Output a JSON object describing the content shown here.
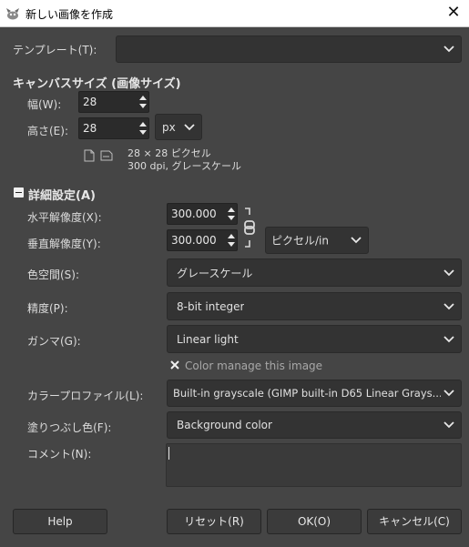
{
  "window": {
    "title": "新しい画像を作成",
    "close_glyph": "✕"
  },
  "template": {
    "label": "テンプレート(T):",
    "value": ""
  },
  "canvas": {
    "section_title": "キャンバスサイズ (画像サイズ)",
    "width_label": "幅(W):",
    "width_value": "28",
    "height_label": "高さ(E):",
    "height_value": "28",
    "unit": "px",
    "info_line1": "28 × 28 ピクセル",
    "info_line2": "300 dpi, グレースケール"
  },
  "advanced": {
    "toggle_glyph": "−",
    "section_title": "詳細設定(A)",
    "xres_label": "水平解像度(X):",
    "xres_value": "300.000",
    "yres_label": "垂直解像度(Y):",
    "yres_value": "300.000",
    "res_unit": "ピクセル/in",
    "colorspace_label": "色空間(S):",
    "colorspace_value": "グレースケール",
    "precision_label": "精度(P):",
    "precision_value": "8-bit integer",
    "gamma_label": "ガンマ(G):",
    "gamma_value": "Linear light",
    "color_manage_label": "Color manage this image",
    "color_manage_checked": true,
    "profile_label": "カラープロファイル(L):",
    "profile_value": "Built-in grayscale (GIMP built-in D65 Linear Grays...",
    "fill_label": "塗りつぶし色(F):",
    "fill_value": "Background color",
    "comment_label": "コメント(N):",
    "comment_value": ""
  },
  "buttons": {
    "help": "Help",
    "reset": "リセット(R)",
    "ok": "OK(O)",
    "cancel": "キャンセル(C)"
  },
  "colors": {
    "background": "#454545",
    "field": "#333333",
    "spin_field": "#2b2b2b",
    "text": "#dcdcdc"
  }
}
